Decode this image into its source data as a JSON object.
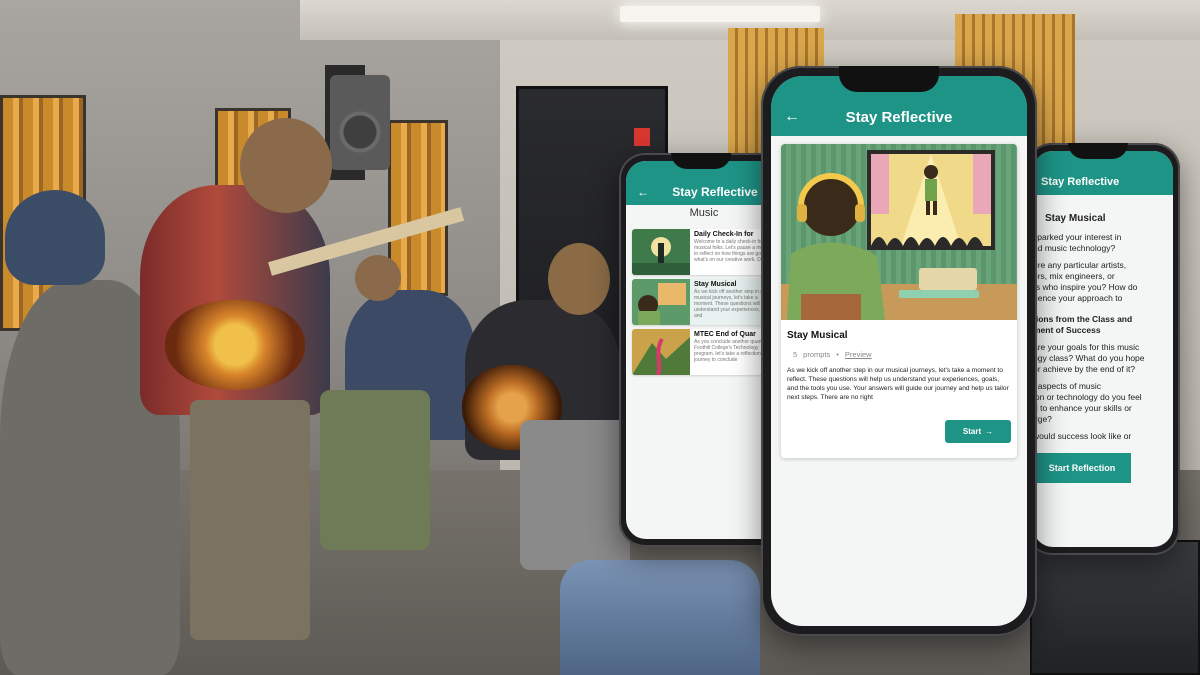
{
  "phones": {
    "left": {
      "title": "Stay Reflective",
      "section": "Music",
      "items": [
        {
          "title": "Daily Check-In for",
          "desc": "Welcome to a daily check-in for musical folks. Let's pause a moment to reflect on how things are going and what's on our creative work. Design"
        },
        {
          "title": "Stay Musical",
          "desc": "As we kick off another step in our musical journeys, let's take a moment. These questions will help us understand your experiences, goals, and"
        },
        {
          "title": "MTEC End of Quar",
          "desc": "As you conclude another quarter at Foothill College's Technology program, let's take a reflection journey to conclude"
        }
      ]
    },
    "center": {
      "title": "Stay Reflective",
      "card": {
        "title": "Stay Musical",
        "prompt_count": "5",
        "prompts_label": "prompts",
        "separator": "•",
        "preview_label": "Preview",
        "description": "As we kick off another step in our musical journeys, let's take a moment to reflect. These questions will help us understand your experiences, goals, and the tools you use. Your answers will guide our journey and help us tailor next steps. There are no right",
        "start_label": "Start",
        "start_icon": "arrow-right-icon"
      }
    },
    "right": {
      "title": "Stay Reflective",
      "heading": "Stay Musical",
      "lines": [
        "sparked your interest in",
        "nd music technology?",
        "ere any particular artists,",
        "ers, mix engineers, or",
        "rs who inspire you? How do",
        "uence your approach to"
      ],
      "section_lines": [
        "tions from the Class and",
        "ment of Success"
      ],
      "lines2": [
        "are your goals for this music",
        "ogy class? What do you hope",
        "or achieve by the end of it?",
        "t aspects of music",
        "ion or technology do you feel",
        "d to enhance your skills or",
        "dge?",
        "would success look like or"
      ],
      "button_label": "Start Reflection"
    }
  },
  "colors": {
    "accent": "#1e9487",
    "screen_bg": "#f4f6f6"
  }
}
